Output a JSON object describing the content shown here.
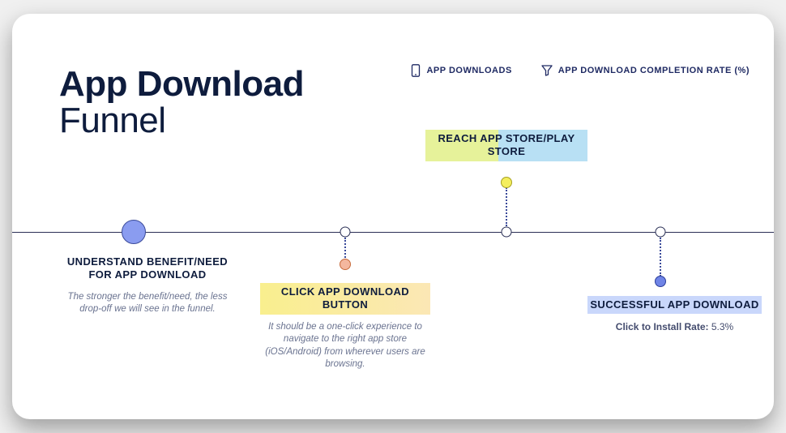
{
  "title": {
    "bold": "App Download",
    "light": "Funnel"
  },
  "legend": {
    "downloads": "APP DOWNLOADS",
    "completion": "APP DOWNLOAD COMPLETION RATE (%)"
  },
  "steps": {
    "s1": {
      "title": "UNDERSTAND BENEFIT/NEED FOR APP DOWNLOAD",
      "desc": "The stronger the benefit/need, the less drop-off we will see in the funnel."
    },
    "s2": {
      "title": "CLICK APP DOWNLOAD BUTTON",
      "desc": "It should be a one-click experience to navigate to the right app store (iOS/Android) from wherever users are browsing."
    },
    "s3": {
      "title": "REACH APP STORE/PLAY STORE"
    },
    "s4": {
      "title": "SUCCESSFUL APP DOWNLOAD",
      "metric_label": "Click to Install Rate:",
      "metric_value": "5.3%"
    }
  }
}
